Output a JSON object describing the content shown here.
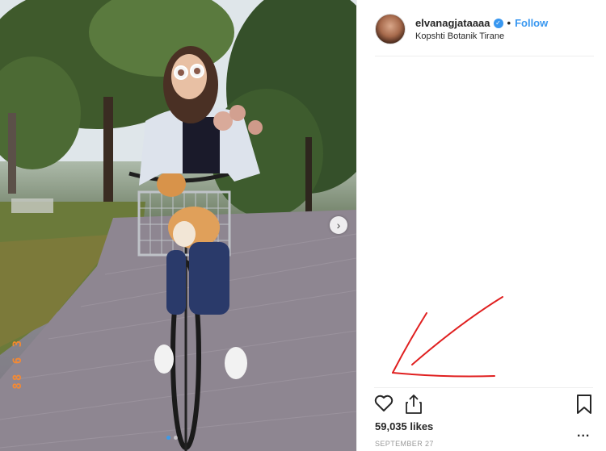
{
  "post": {
    "username": "elvanagjataaaa",
    "separator": "•",
    "follow_label": "Follow",
    "location": "Kopshti Botanik Tirane",
    "likes": "59,035 likes",
    "date": "SEPTEMBER 27",
    "more_label": "...",
    "photo_date_stamp": "88 6 3"
  },
  "carousel": {
    "next_glyph": "›",
    "total_slides": 2,
    "active_slide": 1
  },
  "colors": {
    "accent": "#3897f0",
    "annotation": "#e02020",
    "date_stamp": "#ff8a2a"
  },
  "icons": [
    "heart-icon",
    "share-icon",
    "bookmark-icon",
    "more-icon",
    "verified-icon",
    "chevron-right-icon"
  ]
}
